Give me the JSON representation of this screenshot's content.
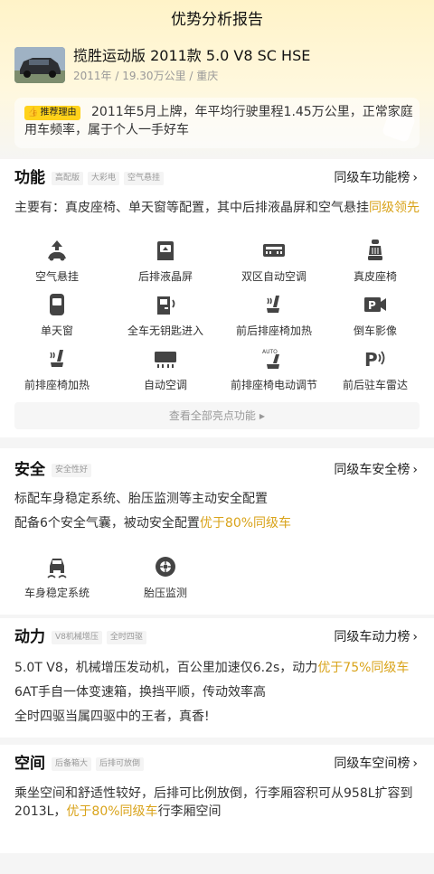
{
  "header": {
    "title": "优势分析报告",
    "car_name": "揽胜运动版 2011款 5.0 V8 SC HSE",
    "car_meta": "2011年 / 19.30万公里 / 重庆"
  },
  "recommend": {
    "badge": "推荐理由",
    "text": "2011年5月上牌，年平均行驶里程1.45万公里，正常家庭用车频率，属于个人一手好车"
  },
  "sections": {
    "features": {
      "title": "功能",
      "tags": [
        "高配版",
        "大彩电",
        "空气悬挂"
      ],
      "rank_link": "同级车功能榜",
      "summary_prefix": "主要有：真皮座椅、单天窗等配置，其中后排液晶屏和空气悬挂",
      "summary_highlight": "同级领先",
      "items": [
        {
          "label": "空气悬挂",
          "icon": "air-suspension-icon"
        },
        {
          "label": "后排液晶屏",
          "icon": "rear-screen-icon"
        },
        {
          "label": "双区自动空调",
          "icon": "dual-zone-ac-icon"
        },
        {
          "label": "真皮座椅",
          "icon": "leather-seat-icon"
        },
        {
          "label": "单天窗",
          "icon": "sunroof-icon"
        },
        {
          "label": "全车无钥匙进入",
          "icon": "keyless-entry-icon"
        },
        {
          "label": "前后排座椅加热",
          "icon": "seat-heating-icon"
        },
        {
          "label": "倒车影像",
          "icon": "reverse-camera-icon"
        },
        {
          "label": "前排座椅加热",
          "icon": "front-seat-heating-icon"
        },
        {
          "label": "自动空调",
          "icon": "auto-ac-icon"
        },
        {
          "label": "前排座椅电动调节",
          "icon": "power-seat-icon"
        },
        {
          "label": "前后驻车雷达",
          "icon": "parking-radar-icon"
        }
      ],
      "more_label": "查看全部亮点功能"
    },
    "safety": {
      "title": "安全",
      "tags": [
        "安全性好"
      ],
      "rank_link": "同级车安全榜",
      "line1": "标配车身稳定系统、胎压监测等主动安全配置",
      "line2_prefix": "配备6个安全气囊，被动安全配置",
      "line2_highlight": "优于80%同级车",
      "items": [
        {
          "label": "车身稳定系统",
          "icon": "stability-control-icon"
        },
        {
          "label": "胎压监测",
          "icon": "tire-pressure-icon"
        }
      ]
    },
    "power": {
      "title": "动力",
      "tags": [
        "V8机械增压",
        "全时四驱"
      ],
      "rank_link": "同级车动力榜",
      "line1_prefix": "5.0T V8，机械增压发动机，百公里加速仅6.2s，动力",
      "line1_highlight": "优于75%同级车",
      "line2": "6AT手自一体变速箱，换挡平顺，传动效率高",
      "line3": "全时四驱当属四驱中的王者，真香!"
    },
    "space": {
      "title": "空间",
      "tags": [
        "后备箱大",
        "后排可放倒"
      ],
      "rank_link": "同级车空间榜",
      "line1": "乘坐空间和舒适性较好，后排可比例放倒，行李厢容积可从958L扩容到",
      "line2_prefix": "2013L，",
      "line2_highlight": "优于80%同级车",
      "line2_suffix": "行李厢空间"
    }
  },
  "colors": {
    "accent": "#d9a31a",
    "badge": "#ffd21a",
    "hero_top": "#fff3c8"
  }
}
